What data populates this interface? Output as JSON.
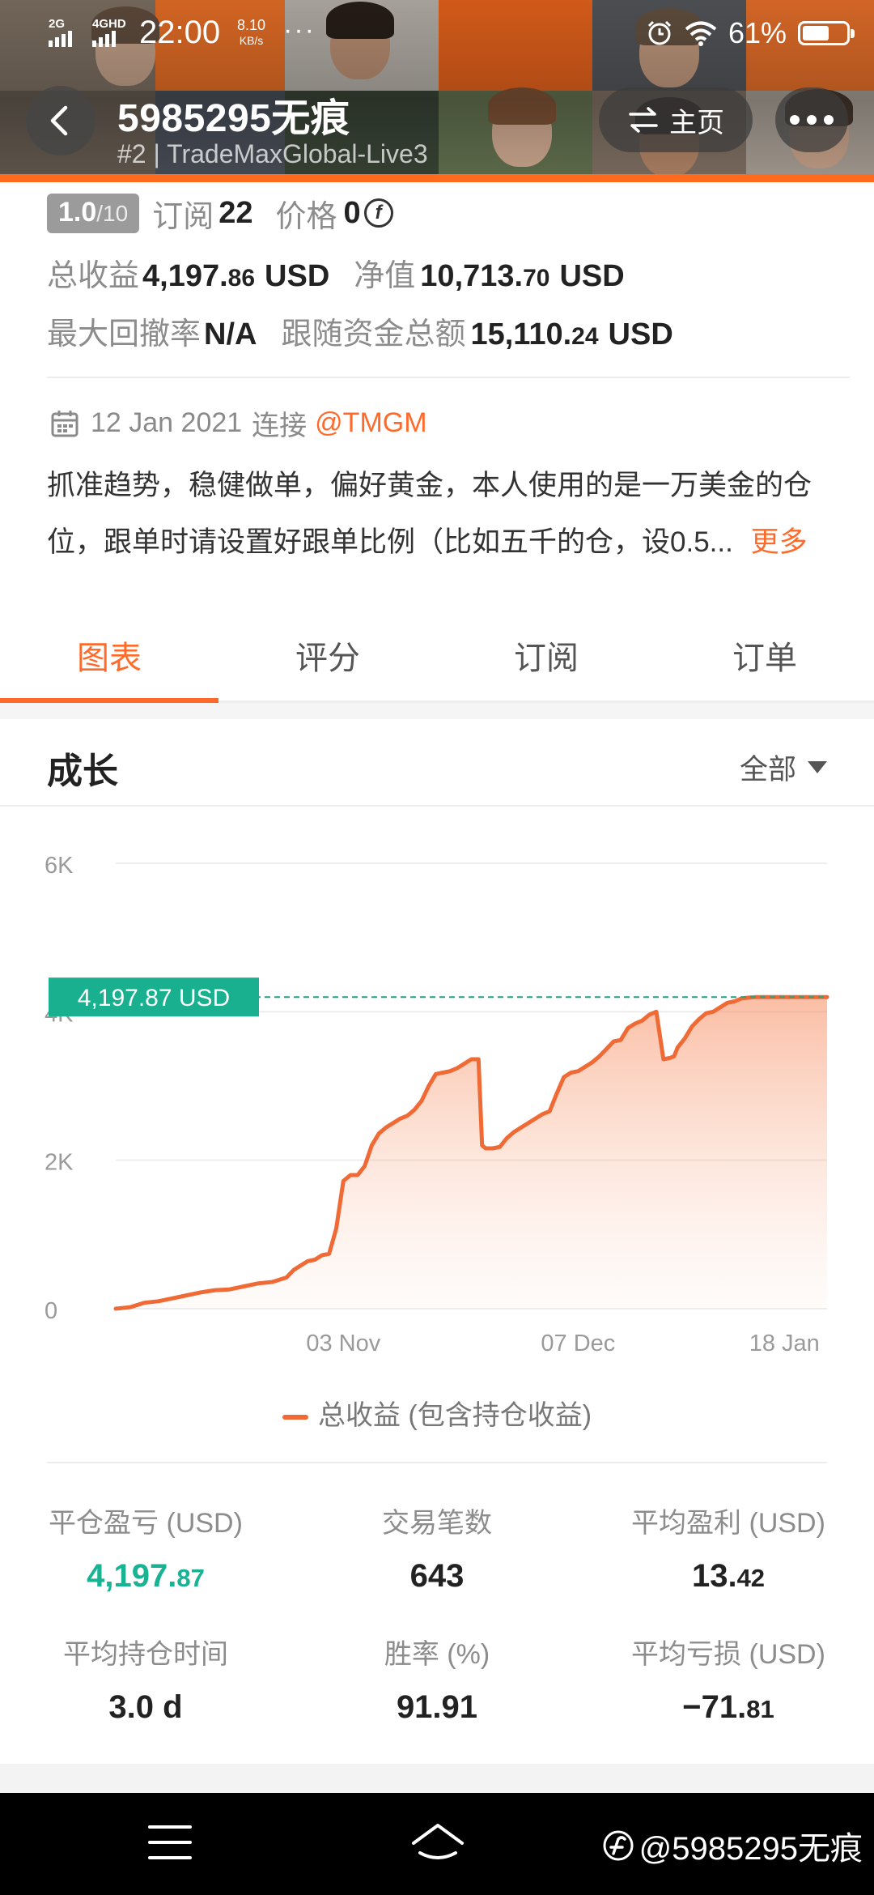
{
  "status_bar": {
    "network_1": "2G",
    "network_2": "4GHD",
    "time": "22:00",
    "speed_value": "8.10",
    "speed_unit": "KB/s",
    "dots": "···",
    "battery": "61%",
    "battery_level": 0.61
  },
  "header": {
    "title": "5985295无痕",
    "subtitle": "#2 | TradeMaxGlobal-Live3",
    "home_label": "主页"
  },
  "summary": {
    "rating_value": "1.0",
    "rating_max": "/10",
    "subscribe_label": "订阅",
    "subscribe_count": "22",
    "price_label": "价格",
    "price_value": "0",
    "total_profit_label": "总收益",
    "total_profit_int": "4,197.",
    "total_profit_dec": "86",
    "currency": "USD",
    "net_value_label": "净值",
    "net_value_int": "10,713.",
    "net_value_dec": "70",
    "max_drawdown_label": "最大回撤率",
    "max_drawdown_value": "N/A",
    "follow_total_label": "跟随资金总额",
    "follow_total_int": "15,110.",
    "follow_total_dec": "24",
    "connect_date": "12 Jan 2021",
    "connect_label": "连接",
    "broker": "@TMGM",
    "description": "抓准趋势，稳健做单，偏好黄金，本人使用的是一万美金的仓位，跟单时请设置好跟单比例（比如五千的仓，设0.5...",
    "more_label": "更多"
  },
  "tabs": [
    {
      "label": "图表",
      "active": true
    },
    {
      "label": "评分",
      "active": false
    },
    {
      "label": "订阅",
      "active": false
    },
    {
      "label": "订单",
      "active": false
    }
  ],
  "section": {
    "title": "成长",
    "range_label": "全部"
  },
  "chart_data": {
    "type": "area",
    "y_ticks": [
      "0",
      "2K",
      "4K",
      "6K"
    ],
    "y_tick_values": [
      0,
      2000,
      4000,
      6000
    ],
    "ylim": [
      0,
      6000
    ],
    "x_ticks": [
      "03 Nov",
      "07 Dec",
      "18 Jan"
    ],
    "x_tick_positions": [
      0.32,
      0.65,
      0.94
    ],
    "callout": "4,197.87 USD",
    "callout_value": 4197.87,
    "series": [
      {
        "name": "总收益 (包含持仓收益)",
        "color": "#f06a35",
        "x": [
          0,
          0.02,
          0.04,
          0.06,
          0.08,
          0.1,
          0.12,
          0.14,
          0.16,
          0.18,
          0.2,
          0.22,
          0.24,
          0.25,
          0.26,
          0.27,
          0.28,
          0.29,
          0.3,
          0.31,
          0.32,
          0.33,
          0.34,
          0.35,
          0.36,
          0.37,
          0.38,
          0.39,
          0.4,
          0.41,
          0.42,
          0.43,
          0.44,
          0.45,
          0.46,
          0.47,
          0.48,
          0.49,
          0.5,
          0.51,
          0.515,
          0.52,
          0.53,
          0.54,
          0.55,
          0.56,
          0.57,
          0.58,
          0.59,
          0.6,
          0.61,
          0.62,
          0.63,
          0.64,
          0.65,
          0.66,
          0.67,
          0.68,
          0.69,
          0.7,
          0.71,
          0.72,
          0.73,
          0.74,
          0.75,
          0.76,
          0.77,
          0.78,
          0.785,
          0.79,
          0.8,
          0.81,
          0.82,
          0.83,
          0.84,
          0.85,
          0.86,
          0.87,
          0.88,
          0.89,
          0.9,
          0.91,
          0.92,
          0.93,
          0.94,
          0.95,
          0.96,
          0.97,
          0.98,
          0.99,
          1.0
        ],
        "y": [
          0,
          20,
          80,
          100,
          140,
          180,
          220,
          250,
          260,
          300,
          340,
          360,
          420,
          520,
          580,
          640,
          660,
          720,
          740,
          1080,
          1720,
          1800,
          1800,
          1920,
          2200,
          2360,
          2440,
          2500,
          2560,
          2600,
          2680,
          2800,
          3000,
          3160,
          3180,
          3200,
          3240,
          3300,
          3360,
          3360,
          2200,
          2160,
          2160,
          2180,
          2300,
          2380,
          2440,
          2500,
          2560,
          2620,
          2660,
          2900,
          3120,
          3180,
          3200,
          3260,
          3320,
          3400,
          3500,
          3600,
          3620,
          3780,
          3840,
          3880,
          3960,
          4000,
          3360,
          3380,
          3400,
          3520,
          3640,
          3800,
          3900,
          3980,
          4000,
          4060,
          4120,
          4140,
          4180,
          4190,
          4197.87,
          4197.87,
          4197.87,
          4197.87,
          4197.87,
          4197.87,
          4197.87,
          4197.87,
          4197.87,
          4197.87,
          4197.87
        ]
      }
    ],
    "grid": true,
    "legend": "bottom-center"
  },
  "legend_label": "总收益 (包含持仓收益)",
  "metrics": [
    {
      "label": "平仓盈亏 (USD)",
      "int": "4,197.",
      "dec": "87",
      "green": true
    },
    {
      "label": "交易笔数",
      "int": "643",
      "dec": "",
      "green": false
    },
    {
      "label": "平均盈利 (USD)",
      "int": "13.",
      "dec": "42",
      "green": false
    },
    {
      "label": "平均持仓时间",
      "int": "3.0 d",
      "dec": "",
      "green": false
    },
    {
      "label": "胜率 (%)",
      "int": "91.91",
      "dec": "",
      "green": false
    },
    {
      "label": "平均亏损 (USD)",
      "int": "−71.",
      "dec": "81",
      "green": false
    }
  ],
  "watermark": "@5985295无痕",
  "icons": {
    "back": "chevron-left-icon",
    "switch": "swap-arrows-icon",
    "more": "more-dots-icon",
    "calendar": "calendar-icon",
    "coin": "coin-icon",
    "dropdown": "caret-down-icon",
    "nav_menu": "menu-icon",
    "nav_home": "home-icon"
  }
}
